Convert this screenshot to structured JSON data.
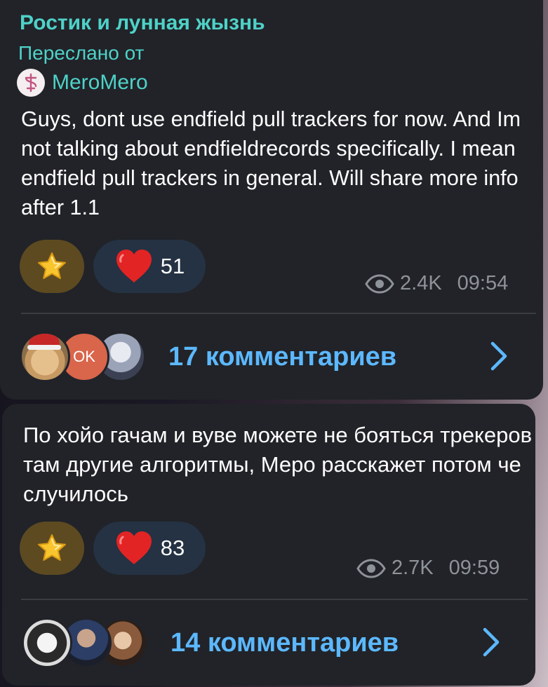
{
  "messages": [
    {
      "channel_name": "Ростик и лунная жызнь",
      "forwarded_label": "Переслано от",
      "forwarded_from": "MeroMero",
      "text": "Guys, dont use endfield pull trackers for now. And Im not talking about endfieldrecords specifically. I mean endfield pull trackers in general. Will share more info after 1.1",
      "reactions": {
        "heart_count": "51"
      },
      "views": "2.4K",
      "time": "09:54",
      "comments_label": "17 комментариев",
      "commenter_badge": "OK"
    },
    {
      "text": "По хойо гачам и вуве можете не бояться трекеров там другие алгоритмы, Меро расскажет потом че случилось",
      "reactions": {
        "heart_count": "83"
      },
      "views": "2.7K",
      "time": "09:59",
      "comments_label": "14 комментариев"
    }
  ],
  "colors": {
    "accent_teal": "#4ed2c8",
    "link_blue": "#5cb8ff",
    "bubble_bg": "#212328",
    "star_reaction_bg": "#5d4a21",
    "heart_reaction_bg": "#243243",
    "muted_text": "#8e9299"
  },
  "icons": [
    "star-reaction-icon",
    "heart-reaction-icon",
    "views-eye-icon",
    "chevron-right-icon"
  ]
}
